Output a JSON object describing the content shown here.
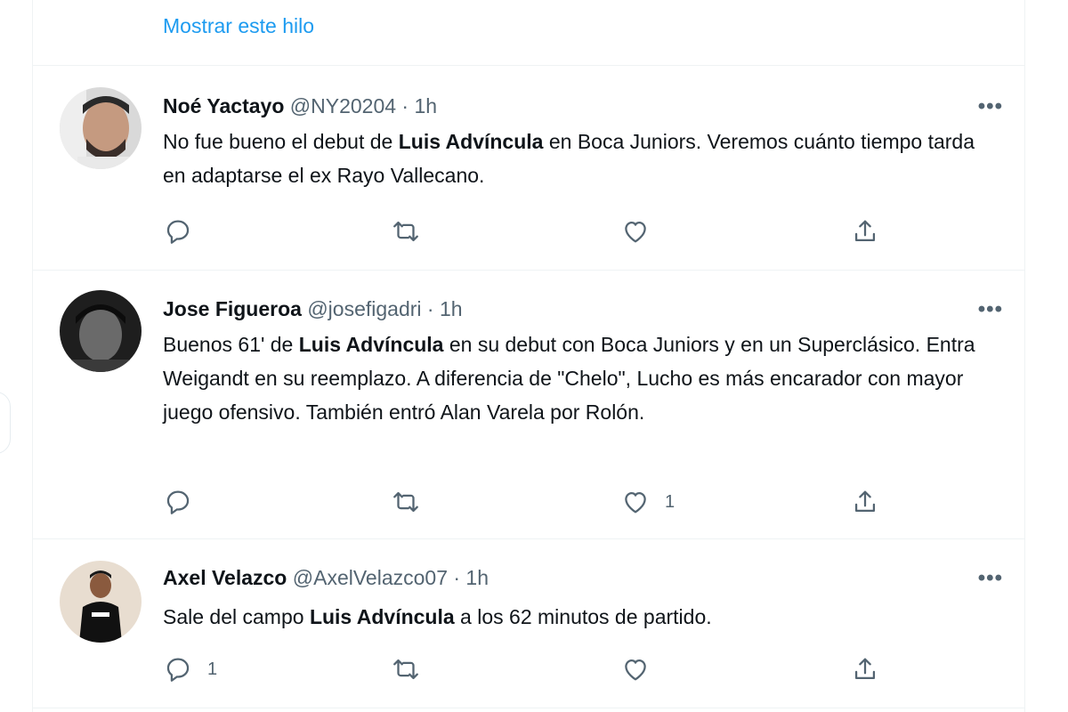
{
  "thread": {
    "show_label": "Mostrar este hilo"
  },
  "tweets": [
    {
      "name": "Noé Yactayo",
      "meta": "@NY20204 · 1h",
      "text_parts": [
        "No fue bueno el debut de ",
        "Luis Advíncula",
        " en Boca Juniors. Veremos cuánto tiempo tarda en adaptarse el ex Rayo Vallecano."
      ],
      "reply_count": "",
      "retweet_count": "",
      "like_count": ""
    },
    {
      "name": "Jose Figueroa",
      "meta": "@josefigadri · 1h",
      "text_parts": [
        "Buenos 61' de ",
        "Luis Advíncula",
        " en su debut con Boca Juniors y en un Superclásico. Entra Weigandt en su reemplazo. A diferencia de \"Chelo\", Lucho es más encarador con mayor juego ofensivo. También entró Alan Varela por Rolón."
      ],
      "reply_count": "",
      "retweet_count": "",
      "like_count": "1"
    },
    {
      "name": "Axel Velazco",
      "meta": "@AxelVelazco07 · 1h",
      "text_parts": [
        "Sale del campo ",
        "Luis Advíncula",
        " a los 62 minutos de partido."
      ],
      "reply_count": "1",
      "retweet_count": "",
      "like_count": ""
    }
  ],
  "more_glyph": "•••",
  "colors": {
    "link": "#1d9bf0",
    "muted": "#536471",
    "text": "#0f1419",
    "divider": "#eff3f4"
  },
  "icons": [
    "reply-icon",
    "retweet-icon",
    "like-icon",
    "share-icon",
    "more-icon"
  ]
}
